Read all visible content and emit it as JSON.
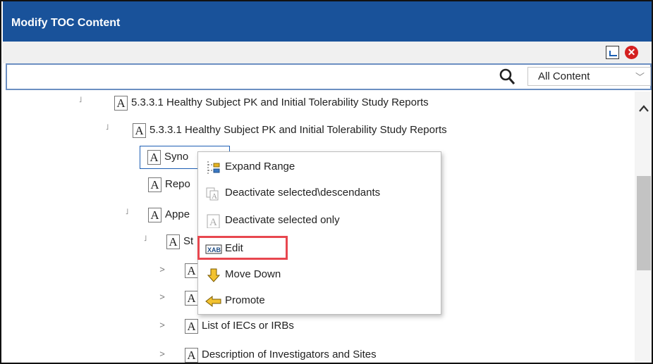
{
  "window": {
    "title": "Modify TOC Content"
  },
  "toolbar": {
    "export_icon": "export-icon",
    "close_icon": "close-circle-icon",
    "close_glyph": "✕"
  },
  "search": {
    "value": "",
    "placeholder": "",
    "filter_value": "All Content",
    "chevron": "﹀",
    "search_glyph": "🔍"
  },
  "tree": {
    "box_letter": "A",
    "collapse_glyph": "˩",
    "expand_glyph": ">",
    "nodes": [
      {
        "label": "5.3.3.1 Healthy Subject PK and Initial Tolerability Study Reports",
        "toggle": "collapse"
      },
      {
        "label": "5.3.3.1 Healthy Subject PK and Initial Tolerability Study Reports",
        "toggle": "collapse"
      },
      {
        "label": "Synopsis",
        "toggle": "none",
        "visible_text": "Syno"
      },
      {
        "label": "Report",
        "toggle": "none",
        "visible_text": "Repo"
      },
      {
        "label": "Appendices",
        "toggle": "collapse",
        "visible_text": "Appe"
      },
      {
        "label": "St",
        "toggle": "collapse",
        "visible_text": "St"
      },
      {
        "label": "",
        "toggle": "expand"
      },
      {
        "label": "",
        "toggle": "expand"
      },
      {
        "label": "List of IECs or IRBs",
        "toggle": "expand"
      },
      {
        "label": "Description of Investigators and Sites",
        "toggle": "expand"
      }
    ]
  },
  "context_menu": {
    "items": [
      {
        "label": "Expand Range",
        "icon": "expand-range-icon"
      },
      {
        "label": "Deactivate selected\\descendants",
        "icon": "deactivate-descendants-icon"
      },
      {
        "label": "Deactivate selected only",
        "icon": "deactivate-selected-icon"
      },
      {
        "label": "Edit",
        "icon": "edit-icon",
        "highlighted": true
      },
      {
        "label": "Move Down",
        "icon": "arrow-down-icon"
      },
      {
        "label": "Promote",
        "icon": "arrow-left-icon"
      }
    ]
  },
  "colors": {
    "titlebar": "#19529a",
    "highlight": "#e8474f",
    "selection_border": "#1e5fb4"
  }
}
